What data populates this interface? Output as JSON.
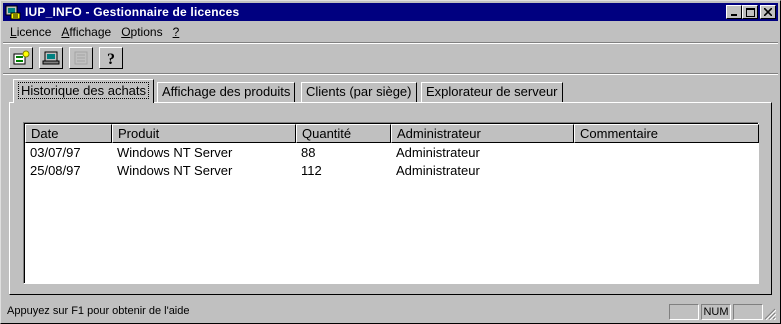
{
  "window": {
    "title": "IUP_INFO - Gestionnaire de licences",
    "app_icon": "license-manager-icon"
  },
  "menu": {
    "items": [
      {
        "label": "Licence",
        "accel": "L"
      },
      {
        "label": "Affichage",
        "accel": "A"
      },
      {
        "label": "Options",
        "accel": "O"
      },
      {
        "label": "?",
        "accel": "?"
      }
    ]
  },
  "toolbar": {
    "buttons": [
      {
        "icon": "new-license-icon",
        "enabled": true
      },
      {
        "icon": "server-properties-icon",
        "enabled": true
      },
      {
        "icon": "properties-icon",
        "enabled": false
      },
      {
        "icon": "help-icon",
        "enabled": true
      }
    ]
  },
  "tabs": [
    {
      "label": "Historique des achats",
      "active": true
    },
    {
      "label": "Affichage des produits",
      "active": false
    },
    {
      "label": "Clients (par siège)",
      "active": false
    },
    {
      "label": "Explorateur de serveur",
      "active": false
    }
  ],
  "table": {
    "columns": [
      "Date",
      "Produit",
      "Quantité",
      "Administrateur",
      "Commentaire"
    ],
    "rows": [
      [
        "03/07/97",
        "Windows NT Server",
        "88",
        "Administrateur",
        ""
      ],
      [
        "25/08/97",
        "Windows NT Server",
        "112",
        "Administrateur",
        ""
      ]
    ]
  },
  "status": {
    "help_text": "Appuyez sur F1 pour obtenir de l'aide",
    "panes": [
      "",
      "NUM",
      ""
    ]
  },
  "colors": {
    "titlebar": "#000080",
    "face": "#c0c0c0"
  }
}
